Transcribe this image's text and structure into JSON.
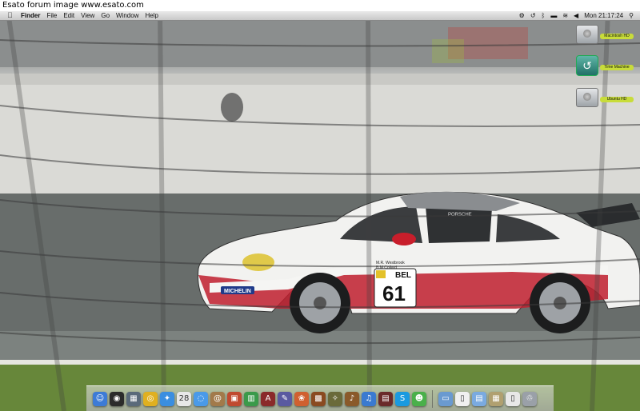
{
  "banner": {
    "text": "Esato forum image www.esato.com"
  },
  "menubar": {
    "apple_icon": "apple-logo-icon",
    "menus": [
      "Finder",
      "File",
      "Edit",
      "View",
      "Go",
      "Window",
      "Help"
    ],
    "status_icons": [
      "sync-icon",
      "time-machine-icon",
      "bluetooth-icon",
      "display-icon",
      "wifi-icon",
      "volume-icon"
    ],
    "clock": "Mon 21:17:24",
    "spotlight_icon": "spotlight-search-icon"
  },
  "desktop": {
    "icons": [
      {
        "label": "Macintosh HD",
        "icon": "hard-drive-icon"
      },
      {
        "label": "Time Machine",
        "icon": "time-machine-icon"
      },
      {
        "label": "Ubuntu HD",
        "icon": "hard-drive-icon"
      }
    ]
  },
  "wallpaper": {
    "car": {
      "number": "61",
      "country": "BEL",
      "drivers": "M.R. Westbrook\nB.M Collard",
      "sponsor": "MICHELIN",
      "brand": "PORSCHE"
    }
  },
  "dock": {
    "apps": [
      {
        "icon": "finder-icon",
        "color": "#3d7bd6",
        "glyph": "☺"
      },
      {
        "icon": "dashboard-icon",
        "color": "#2b2b2b",
        "glyph": "◉"
      },
      {
        "icon": "expose-icon",
        "color": "#5a6a7a",
        "glyph": "▦"
      },
      {
        "icon": "chrome-icon",
        "color": "#e0b020",
        "glyph": "◎"
      },
      {
        "icon": "safari-icon",
        "color": "#3a8ee0",
        "glyph": "✦"
      },
      {
        "icon": "ical-icon",
        "color": "#e8e8e8",
        "glyph": "28"
      },
      {
        "icon": "ichat-icon",
        "color": "#4a9ae8",
        "glyph": "◌"
      },
      {
        "icon": "address-book-icon",
        "color": "#a27a4a",
        "glyph": "@"
      },
      {
        "icon": "keynote-icon",
        "color": "#c04a30",
        "glyph": "▣"
      },
      {
        "icon": "numbers-icon",
        "color": "#3a9a4a",
        "glyph": "▥"
      },
      {
        "icon": "dictionary-icon",
        "color": "#8a2a2a",
        "glyph": "A"
      },
      {
        "icon": "pencil-icon",
        "color": "#5a5aa0",
        "glyph": "✎"
      },
      {
        "icon": "iphoto-icon",
        "color": "#d06030",
        "glyph": "❀"
      },
      {
        "icon": "photo-booth-icon",
        "color": "#8a4a20",
        "glyph": "▩"
      },
      {
        "icon": "tools-icon",
        "color": "#6a6a3a",
        "glyph": "✧"
      },
      {
        "icon": "garageband-icon",
        "color": "#8a5a2a",
        "glyph": "♪"
      },
      {
        "icon": "itunes-icon",
        "color": "#3a7ad0",
        "glyph": "♫"
      },
      {
        "icon": "photo-app-icon",
        "color": "#6a2a2a",
        "glyph": "▤"
      },
      {
        "icon": "skype-icon",
        "color": "#1a9ae0",
        "glyph": "S"
      },
      {
        "icon": "msn-icon",
        "color": "#4ab04a",
        "glyph": "☻"
      }
    ],
    "stacks": [
      {
        "icon": "applications-folder-icon",
        "color": "#6a9ad0",
        "glyph": "▭"
      },
      {
        "icon": "document-icon",
        "color": "#f0f0f0",
        "glyph": "▯"
      },
      {
        "icon": "downloads-folder-icon",
        "color": "#7aaae0",
        "glyph": "▤"
      },
      {
        "icon": "preview-stack-icon",
        "color": "#b0a070",
        "glyph": "▦"
      },
      {
        "icon": "notes-stack-icon",
        "color": "#e8e8e8",
        "glyph": "▯"
      },
      {
        "icon": "trash-icon",
        "color": "#9aa0a8",
        "glyph": "♲"
      }
    ]
  }
}
